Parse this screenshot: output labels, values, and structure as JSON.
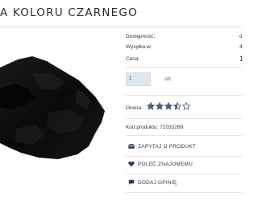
{
  "product": {
    "title": "A KOLORU CZARNEGO"
  },
  "info": {
    "availability_label": "Dostępność:",
    "availability_value": "d",
    "shipping_label": "Wysyłka w:",
    "shipping_value": "4",
    "price_label": "Cena:",
    "price_value": "1",
    "quantity_value": "1",
    "quantity_unit": "szt.",
    "rating_label": "Ocena:",
    "rating_value": 3.5,
    "rating_max": 5,
    "code_label": "Kod produktu:",
    "code_value": "71033289"
  },
  "actions": {
    "ask_label": "ZAPYTAJ O PRODUKT",
    "recommend_label": "POLEĆ ZNAJOMEMU",
    "review_label": "DODAJ OPINIĘ"
  },
  "icons": {
    "ask": "envelope-icon",
    "recommend": "heart-icon",
    "review": "comment-icon"
  },
  "colors": {
    "action_text": "#2b3a55",
    "star": "#4a5d80",
    "quantity_bg": "#dfe6f0"
  }
}
